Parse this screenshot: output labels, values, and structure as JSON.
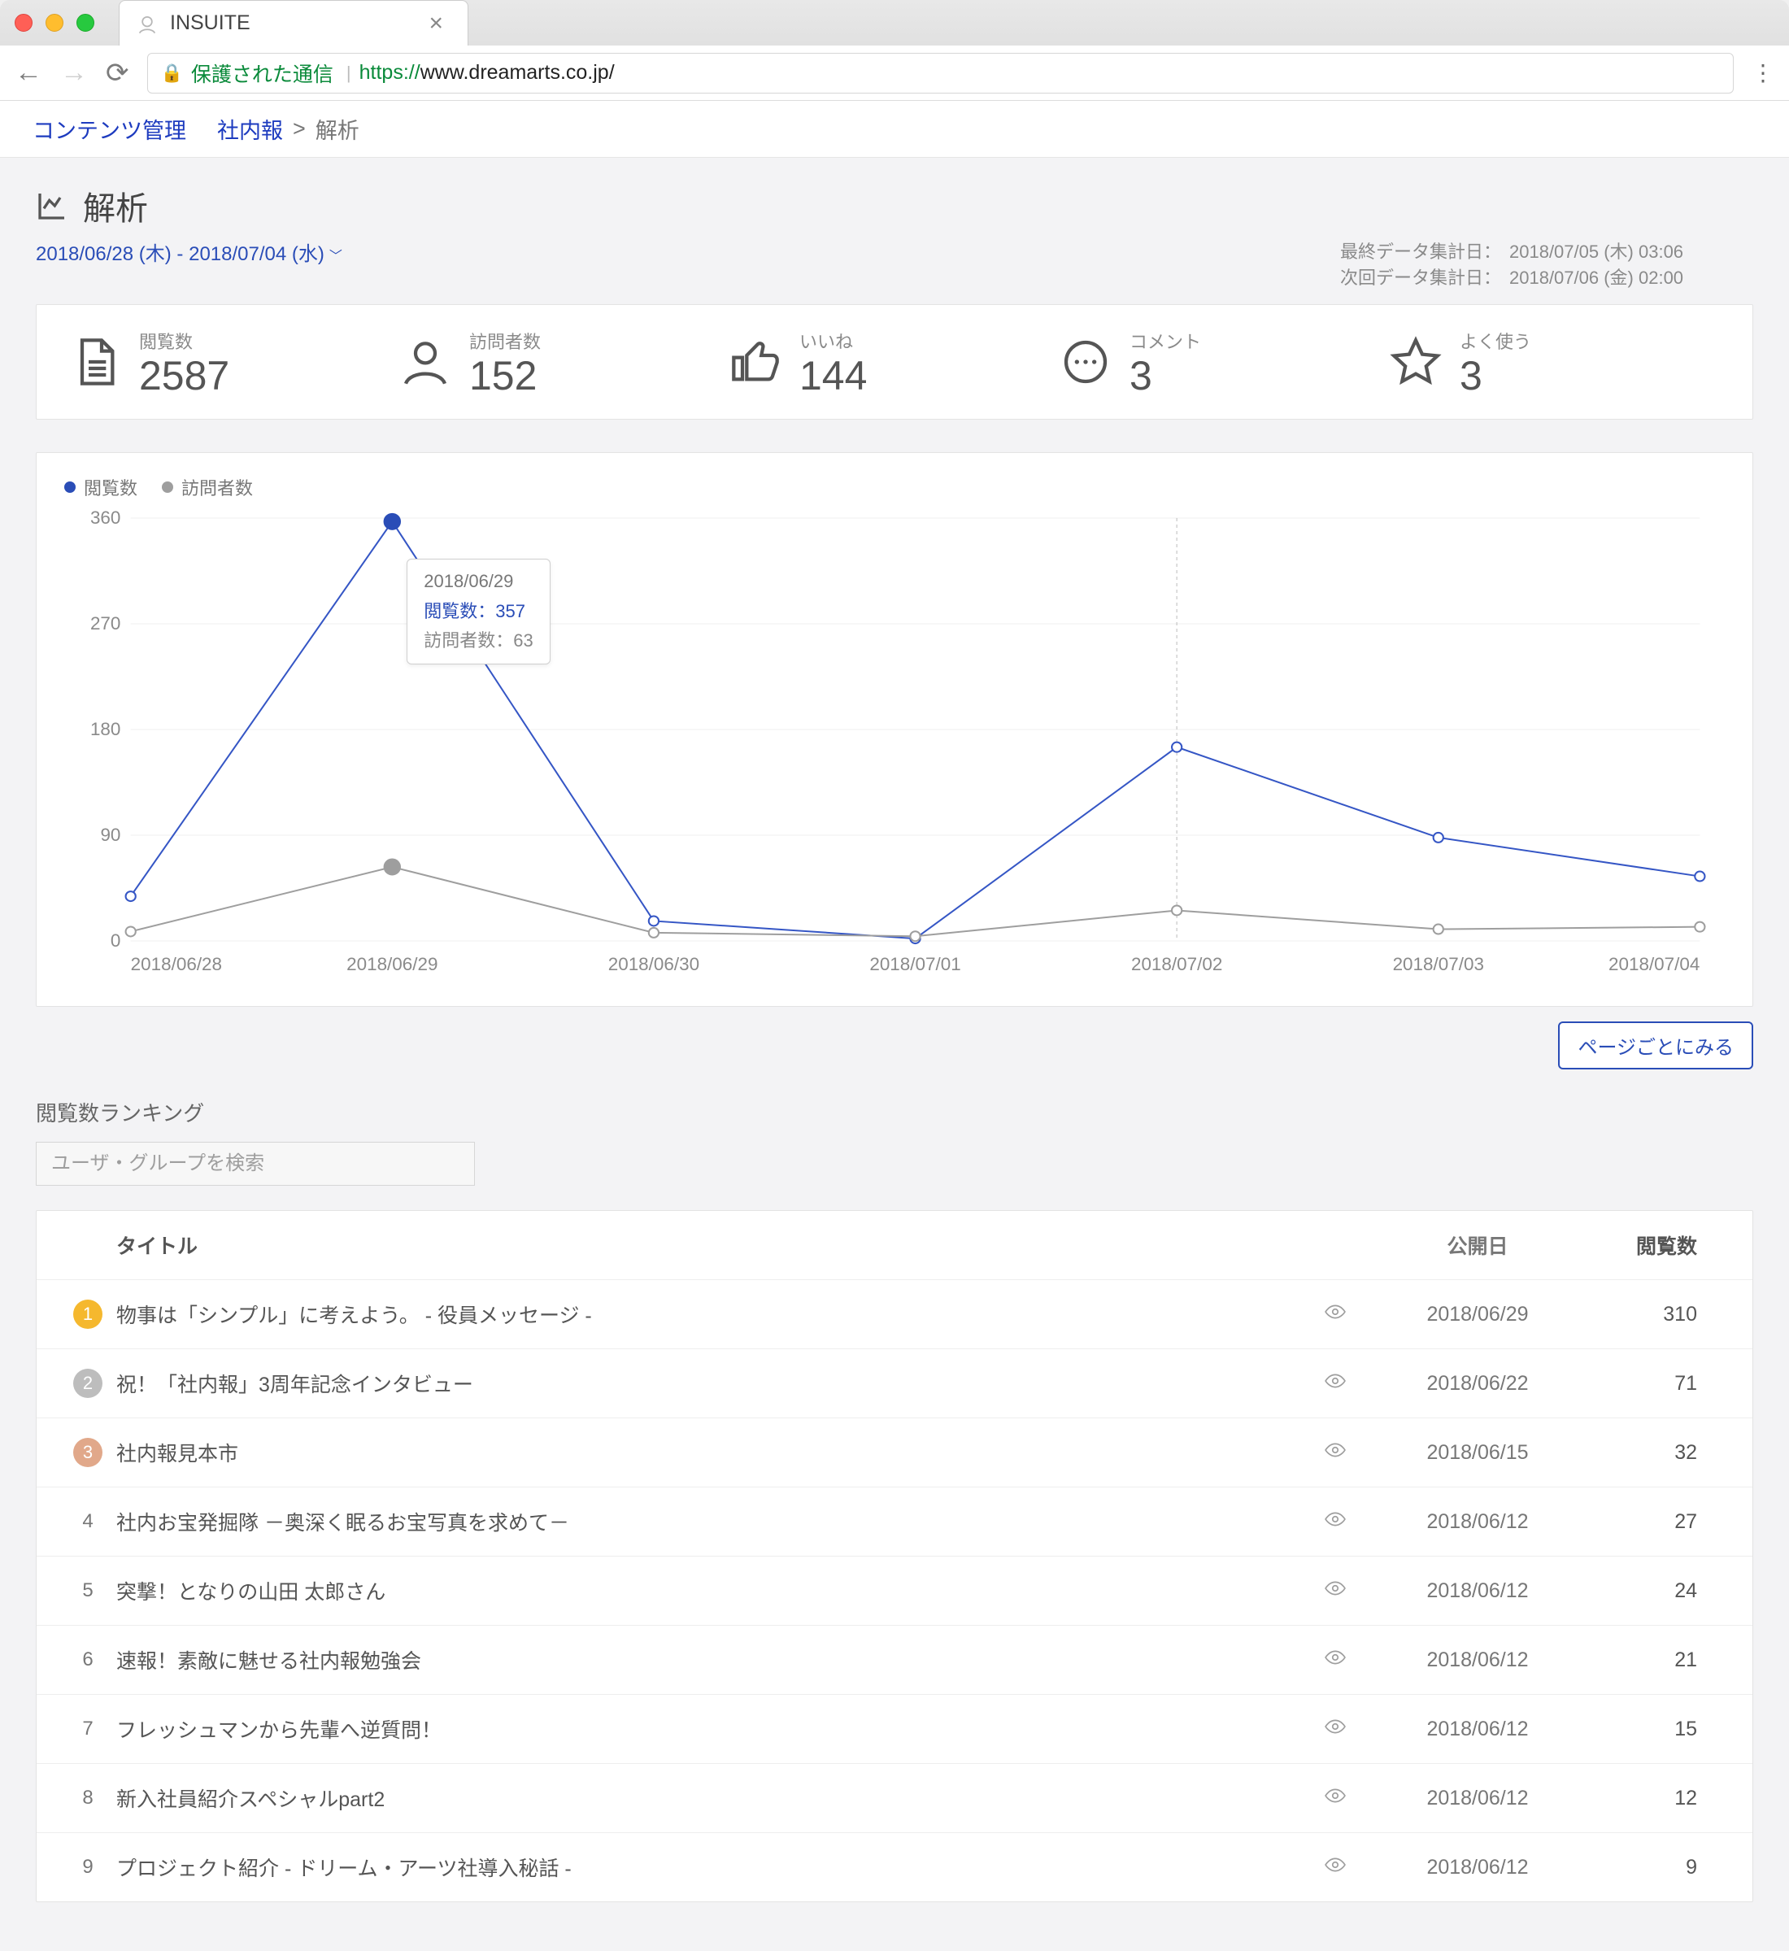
{
  "browser": {
    "tab_title": "INSUITE",
    "secure_label": "保護された通信",
    "url_proto": "https://",
    "url_host": "www.dreamarts.co.jp/"
  },
  "breadcrumb": {
    "mgmt": "コンテンツ管理",
    "parent": "社内報",
    "sep": ">",
    "current": "解析"
  },
  "page": {
    "title": "解析",
    "date_range": "2018/06/28 (木) - 2018/07/04 (水)"
  },
  "agg": {
    "last_label": "最終データ集計日：",
    "last_time": "2018/07/05 (木) 03:06",
    "next_label": "次回データ集計日：",
    "next_time": "2018/07/06 (金) 02:00"
  },
  "stats": {
    "views_label": "閲覧数",
    "views_value": "2587",
    "visitors_label": "訪問者数",
    "visitors_value": "152",
    "likes_label": "いいね",
    "likes_value": "144",
    "comments_label": "コメント",
    "comments_value": "3",
    "fav_label": "よく使う",
    "fav_value": "3"
  },
  "legend": {
    "views": "閲覧数",
    "visitors": "訪問者数"
  },
  "tooltip": {
    "date": "2018/06/29",
    "line1": "閲覧数：357",
    "line2": "訪問者数：63"
  },
  "per_page_btn": "ページごとにみる",
  "ranking_title": "閲覧数ランキング",
  "search_placeholder": "ユーザ・グループを検索",
  "table_headers": {
    "title": "タイトル",
    "date": "公開日",
    "views": "閲覧数"
  },
  "rows": [
    {
      "rank": "1",
      "title": "物事は「シンプル」に考えよう。 - 役員メッセージ -",
      "date": "2018/06/29",
      "views": "310"
    },
    {
      "rank": "2",
      "title": "祝！「社内報」3周年記念インタビュー",
      "date": "2018/06/22",
      "views": "71"
    },
    {
      "rank": "3",
      "title": "社内報見本市",
      "date": "2018/06/15",
      "views": "32"
    },
    {
      "rank": "4",
      "title": "社内お宝発掘隊 －奥深く眠るお宝写真を求めて－",
      "date": "2018/06/12",
      "views": "27"
    },
    {
      "rank": "5",
      "title": "突撃！となりの山田 太郎さん",
      "date": "2018/06/12",
      "views": "24"
    },
    {
      "rank": "6",
      "title": "速報！素敵に魅せる社内報勉強会",
      "date": "2018/06/12",
      "views": "21"
    },
    {
      "rank": "7",
      "title": "フレッシュマンから先輩へ逆質問！",
      "date": "2018/06/12",
      "views": "15"
    },
    {
      "rank": "8",
      "title": "新入社員紹介スペシャルpart2",
      "date": "2018/06/12",
      "views": "12"
    },
    {
      "rank": "9",
      "title": "プロジェクト紹介 - ドリーム・アーツ社導入秘話 -",
      "date": "2018/06/12",
      "views": "9"
    }
  ],
  "chart_data": {
    "type": "line",
    "xlabel": "",
    "ylabel": "",
    "ylim": [
      0,
      360
    ],
    "y_ticks": [
      0,
      90,
      180,
      270,
      360
    ],
    "categories": [
      "2018/06/28",
      "2018/06/29",
      "2018/06/30",
      "2018/07/01",
      "2018/07/02",
      "2018/07/03",
      "2018/07/04"
    ],
    "series": [
      {
        "name": "閲覧数",
        "color": "#3556c5",
        "values": [
          38,
          357,
          17,
          2,
          165,
          88,
          55
        ]
      },
      {
        "name": "訪問者数",
        "color": "#9e9e9e",
        "values": [
          8,
          63,
          7,
          4,
          26,
          10,
          12
        ]
      }
    ],
    "selected_index": 1,
    "hover_index": 4
  }
}
